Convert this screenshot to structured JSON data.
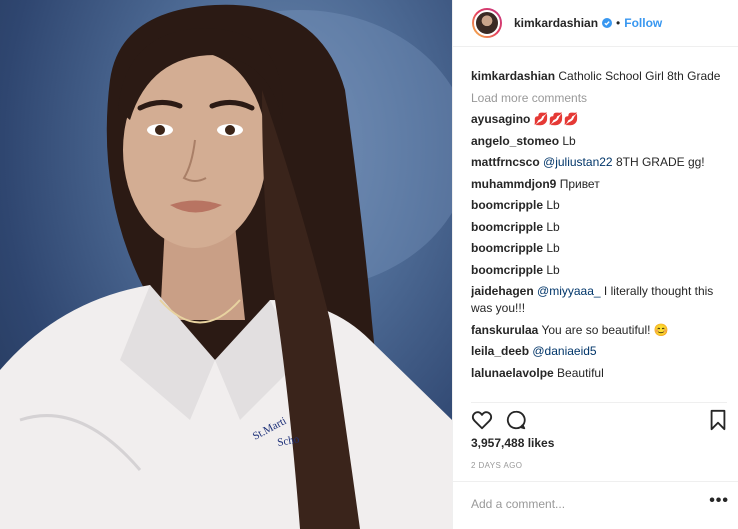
{
  "header": {
    "username": "kimkardashian",
    "follow_label": "Follow",
    "separator": "•"
  },
  "caption": {
    "username": "kimkardashian",
    "text": "Catholic School Girl 8th Grade"
  },
  "load_more_label": "Load more comments",
  "comments": [
    {
      "user": "ayusagino",
      "text": "💋💋💋",
      "mention": ""
    },
    {
      "user": "angelo_stomeo",
      "text": "Lb",
      "mention": ""
    },
    {
      "user": "mattfrncsco",
      "text": "8TH GRADE gg!",
      "mention": "@juliustan22"
    },
    {
      "user": "muhammdjon9",
      "text": "Привет",
      "mention": ""
    },
    {
      "user": "boomcripple",
      "text": "Lb",
      "mention": ""
    },
    {
      "user": "boomcripple",
      "text": "Lb",
      "mention": ""
    },
    {
      "user": "boomcripple",
      "text": "Lb",
      "mention": ""
    },
    {
      "user": "boomcripple",
      "text": "Lb",
      "mention": ""
    },
    {
      "user": "jaidehagen",
      "text": "I literally thought this was you!!!",
      "mention": "@miyyaaa_"
    },
    {
      "user": "fanskurulaa",
      "text": "You are so beautiful! 😊",
      "mention": ""
    },
    {
      "user": "leila_deeb",
      "text": "",
      "mention": "@daniaeid5"
    },
    {
      "user": "lalunaelavolpe",
      "text": "Beautiful",
      "mention": ""
    }
  ],
  "likes": "3,957,488 likes",
  "timestamp": "2 DAYS AGO",
  "add_comment_placeholder": "Add a comment...",
  "more_options": "•••",
  "photo_text": "St.Marti Scho",
  "icons": {
    "like": "heart-icon",
    "comment": "comment-icon",
    "save": "bookmark-icon",
    "verified": "verified-badge-icon",
    "more": "more-options-icon"
  },
  "colors": {
    "link": "#3897f0",
    "mention": "#003569",
    "muted": "#999999",
    "text": "#262626"
  }
}
